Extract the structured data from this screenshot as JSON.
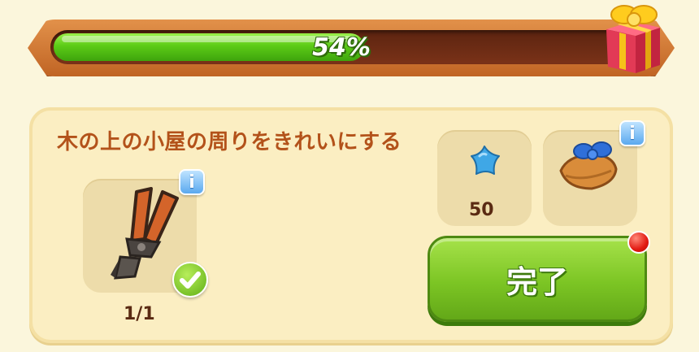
{
  "progress": {
    "value": 0.54,
    "label": "54%"
  },
  "reward_icon": "gift-box-icon",
  "quest": {
    "title": "木の上の小屋の周りをきれいにする",
    "requirement": {
      "icon": "bolt-cutters-icon",
      "count": "1/1",
      "completed": true
    },
    "rewards": [
      {
        "icon": "blue-star-icon",
        "amount": "50"
      },
      {
        "icon": "wrapped-present-icon"
      }
    ],
    "complete_button": "完了"
  },
  "colors": {
    "progress_fill": "#5ccb17",
    "title_text": "#b3521a",
    "button_green": "#7cc524",
    "notification": "#e21a12"
  }
}
